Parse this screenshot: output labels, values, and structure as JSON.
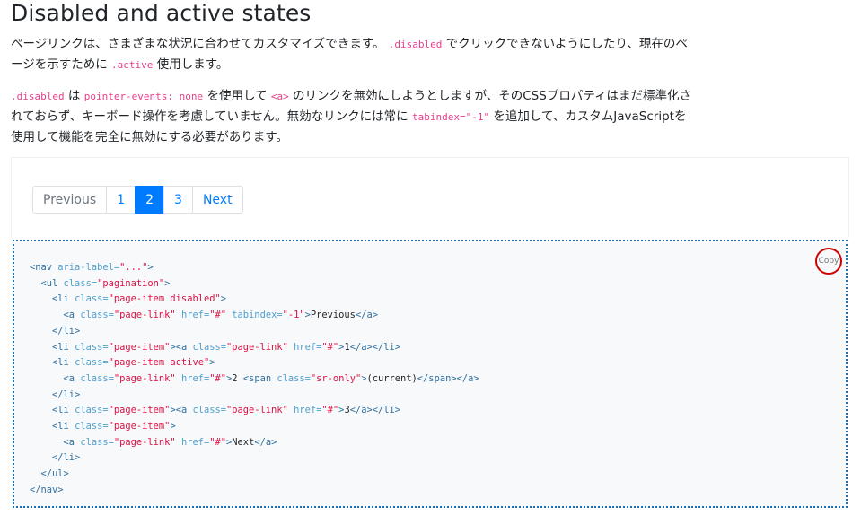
{
  "heading": "Disabled and active states",
  "para1": {
    "t1": "ページリンクは、さまざまな状況に合わせてカスタマイズできます。",
    "c1": ".disabled",
    "t2": "でクリックできないようにしたり、現在のページを示すために",
    "c2": ".active",
    "t3": "使用します。"
  },
  "para2": {
    "c1": ".disabled",
    "t1": "は",
    "c2": "pointer-events: none",
    "t2": "を使用して",
    "c3": "<a>",
    "t3": "のリンクを無効にしようとしますが、そのCSSプロパティはまだ標準化されておらず、キーボード操作を考慮していません。無効なリンクには常に",
    "c4": "tabindex=\"-1\"",
    "t4": "を追加して、カスタムJavaScriptを使用して機能を完全に無効にする必要があります。"
  },
  "pagination": {
    "previous": "Previous",
    "p1": "1",
    "p2": "2",
    "p3": "3",
    "next": "Next"
  },
  "copy_label": "Copy",
  "code": {
    "l1": {
      "open": "<nav ",
      "a1": "aria-label=",
      "v1": "\"...\"",
      "close": ">"
    },
    "l2": {
      "open": "<ul ",
      "a1": "class=",
      "v1": "\"pagination\"",
      "close": ">"
    },
    "l3": {
      "open": "<li ",
      "a1": "class=",
      "v1": "\"page-item disabled\"",
      "close": ">"
    },
    "l4": {
      "open": "<a ",
      "a1": "class=",
      "v1": "\"page-link\"",
      "a2": " href=",
      "v2": "\"#\"",
      "a3": " tabindex=",
      "v3": "\"-1\"",
      "gt": ">",
      "text": "Previous",
      "end": "</a>"
    },
    "l5": "</li>",
    "l6": {
      "open": "<li ",
      "a1": "class=",
      "v1": "\"page-item\"",
      "m": "><a ",
      "a2": "class=",
      "v2": "\"page-link\"",
      "a3": " href=",
      "v3": "\"#\"",
      "gt": ">",
      "text": "1",
      "end": "</a></li>"
    },
    "l7": {
      "open": "<li ",
      "a1": "class=",
      "v1": "\"page-item active\"",
      "close": ">"
    },
    "l8": {
      "open": "<a ",
      "a1": "class=",
      "v1": "\"page-link\"",
      "a2": " href=",
      "v2": "\"#\"",
      "gt": ">",
      "text": "2 ",
      "sopen": "<span ",
      "a3": "class=",
      "v3": "\"sr-only\"",
      "gt2": ">",
      "text2": "(current)",
      "end": "</span></a>"
    },
    "l9": "</li>",
    "l10": {
      "open": "<li ",
      "a1": "class=",
      "v1": "\"page-item\"",
      "m": "><a ",
      "a2": "class=",
      "v2": "\"page-link\"",
      "a3": " href=",
      "v3": "\"#\"",
      "gt": ">",
      "text": "3",
      "end": "</a></li>"
    },
    "l11": {
      "open": "<li ",
      "a1": "class=",
      "v1": "\"page-item\"",
      "close": ">"
    },
    "l12": {
      "open": "<a ",
      "a1": "class=",
      "v1": "\"page-link\"",
      "a2": " href=",
      "v2": "\"#\"",
      "gt": ">",
      "text": "Next",
      "end": "</a>"
    },
    "l13": "</li>",
    "l14": "</ul>",
    "l15": "</nav>"
  }
}
